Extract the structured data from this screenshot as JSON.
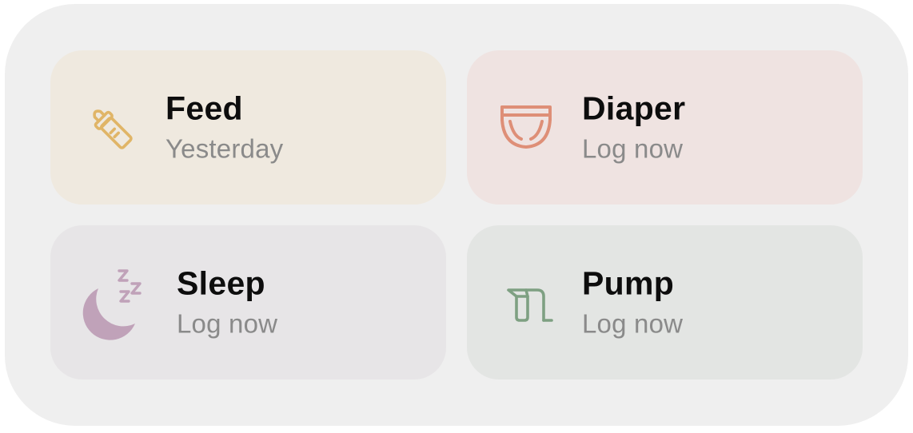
{
  "tiles": {
    "feed": {
      "title": "Feed",
      "status": "Yesterday",
      "icon": "baby-bottle-icon",
      "bg": "#efe9df",
      "accent": "#e0b567"
    },
    "diaper": {
      "title": "Diaper",
      "status": "Log now",
      "icon": "diaper-icon",
      "bg": "#efe3e1",
      "accent": "#de8f77"
    },
    "sleep": {
      "title": "Sleep",
      "status": "Log now",
      "icon": "moon-zzz-icon",
      "bg": "#e7e5e7",
      "accent": "#c0a2b9"
    },
    "pump": {
      "title": "Pump",
      "status": "Log now",
      "icon": "breast-pump-icon",
      "bg": "#e3e5e3",
      "accent": "#7ea082"
    }
  }
}
